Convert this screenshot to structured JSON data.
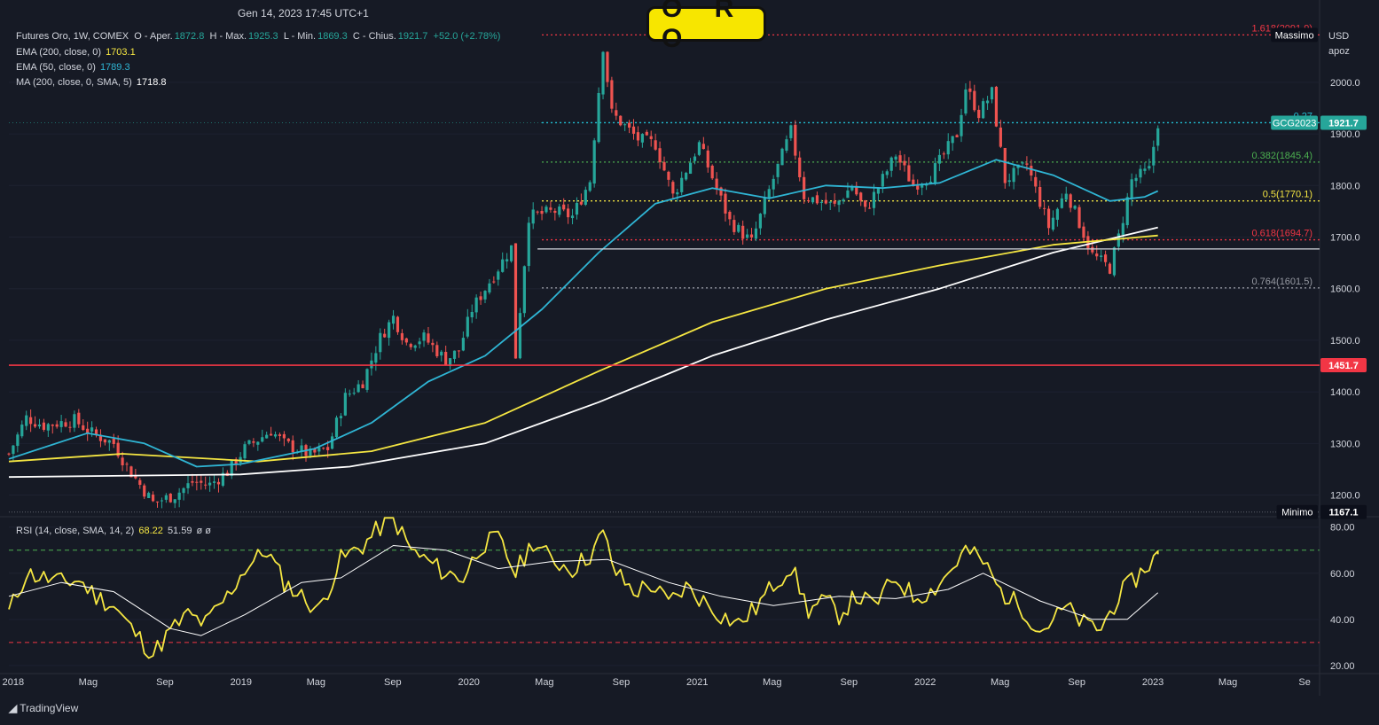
{
  "header": {
    "datetime": "Gen 14, 2023 17:45 UTC+1",
    "title": "O R O",
    "currency": "USD",
    "scale_label": "apoz",
    "watermark": "TradingView"
  },
  "legend": {
    "symbol_line": {
      "name": "Futures Oro, 1W, COMEX",
      "open_label": "O - Aper.",
      "open": "1872.8",
      "high_label": "H - Max.",
      "high": "1925.3",
      "low_label": "L - Min.",
      "low": "1869.3",
      "close_label": "C - Chius.",
      "close": "1921.7",
      "change": "+52.0 (+2.78%)"
    },
    "ema200": {
      "label": "EMA (200, close, 0)",
      "value": "1703.1",
      "color": "#f5e642"
    },
    "ema50": {
      "label": "EMA (50, close, 0)",
      "value": "1789.3",
      "color": "#2fb5d4"
    },
    "ma200": {
      "label": "MA (200, close, 0, SMA, 5)",
      "value": "1718.8",
      "color": "#ffffff"
    },
    "rsi": {
      "label": "RSI (14, close, SMA, 14, 2)",
      "value": "68.22",
      "value2": "51.59",
      "extra": "ø ø"
    }
  },
  "colors": {
    "background": "#161a25",
    "up": "#26a69a",
    "down": "#ef5350",
    "grid": "#1e2230",
    "ema200": "#f5e642",
    "ema50": "#2fb5d4",
    "ma200": "#ffffff",
    "support": "#f23645"
  },
  "chart_data": [
    {
      "type": "candlestick",
      "symbol": "GCG2023",
      "timeframe": "1W",
      "y_ticks": [
        "2000.0",
        "1900.0",
        "1800.0",
        "1700.0",
        "1600.0",
        "1500.0",
        "1400.0",
        "1300.0",
        "1200.0"
      ],
      "ylim": [
        1158,
        2108
      ],
      "x_ticks": [
        "2018",
        "Mag",
        "Sep",
        "2019",
        "Mag",
        "Sep",
        "2020",
        "Mag",
        "Sep",
        "2021",
        "Mag",
        "Sep",
        "2022",
        "Mag",
        "Sep",
        "2023",
        "Mag",
        "Se"
      ],
      "xlim": [
        "2017-12-25",
        "2023-09-25"
      ],
      "price_path": [
        [
          "2017-12-25",
          1280
        ],
        [
          "2018-01-22",
          1350
        ],
        [
          "2018-02-19",
          1335
        ],
        [
          "2018-04-09",
          1345
        ],
        [
          "2018-05-07",
          1320
        ],
        [
          "2018-06-11",
          1300
        ],
        [
          "2018-07-02",
          1255
        ],
        [
          "2018-08-13",
          1185
        ],
        [
          "2018-09-17",
          1200
        ],
        [
          "2018-10-15",
          1225
        ],
        [
          "2018-11-12",
          1220
        ],
        [
          "2018-12-10",
          1245
        ],
        [
          "2019-01-07",
          1290
        ],
        [
          "2019-02-18",
          1325
        ],
        [
          "2019-03-11",
          1300
        ],
        [
          "2019-04-22",
          1278
        ],
        [
          "2019-05-20",
          1290
        ],
        [
          "2019-06-17",
          1390
        ],
        [
          "2019-07-15",
          1420
        ],
        [
          "2019-08-12",
          1505
        ],
        [
          "2019-09-02",
          1545
        ],
        [
          "2019-09-23",
          1495
        ],
        [
          "2019-10-21",
          1505
        ],
        [
          "2019-11-25",
          1462
        ],
        [
          "2019-12-16",
          1480
        ],
        [
          "2020-01-06",
          1560
        ],
        [
          "2020-02-17",
          1640
        ],
        [
          "2020-03-09",
          1680
        ],
        [
          "2020-03-16",
          1470
        ],
        [
          "2020-04-06",
          1740
        ],
        [
          "2020-05-18",
          1750
        ],
        [
          "2020-06-15",
          1740
        ],
        [
          "2020-07-13",
          1810
        ],
        [
          "2020-08-03",
          2070
        ],
        [
          "2020-08-17",
          1940
        ],
        [
          "2020-09-28",
          1890
        ],
        [
          "2020-10-26",
          1880
        ],
        [
          "2020-11-23",
          1780
        ],
        [
          "2021-01-04",
          1880
        ],
        [
          "2021-02-22",
          1730
        ],
        [
          "2021-03-29",
          1690
        ],
        [
          "2021-04-26",
          1790
        ],
        [
          "2021-05-31",
          1905
        ],
        [
          "2021-06-21",
          1780
        ],
        [
          "2021-08-09",
          1760
        ],
        [
          "2021-09-06",
          1800
        ],
        [
          "2021-09-27",
          1750
        ],
        [
          "2021-11-15",
          1860
        ],
        [
          "2021-12-13",
          1800
        ],
        [
          "2022-01-10",
          1820
        ],
        [
          "2022-02-21",
          1900
        ],
        [
          "2022-03-07",
          1990
        ],
        [
          "2022-03-28",
          1940
        ],
        [
          "2022-04-18",
          1980
        ],
        [
          "2022-05-09",
          1810
        ],
        [
          "2022-06-13",
          1840
        ],
        [
          "2022-07-18",
          1720
        ],
        [
          "2022-08-15",
          1790
        ],
        [
          "2022-09-26",
          1665
        ],
        [
          "2022-10-24",
          1640
        ],
        [
          "2022-11-07",
          1700
        ],
        [
          "2022-11-28",
          1810
        ],
        [
          "2022-12-26",
          1830
        ],
        [
          "2023-01-09",
          1921.7
        ]
      ],
      "ema50_path": [
        [
          "2017-12-25",
          1270
        ],
        [
          "2018-04-30",
          1320
        ],
        [
          "2018-07-30",
          1300
        ],
        [
          "2018-10-22",
          1255
        ],
        [
          "2018-12-31",
          1260
        ],
        [
          "2019-04-29",
          1290
        ],
        [
          "2019-07-29",
          1340
        ],
        [
          "2019-10-28",
          1420
        ],
        [
          "2020-01-27",
          1470
        ],
        [
          "2020-04-27",
          1560
        ],
        [
          "2020-07-27",
          1670
        ],
        [
          "2020-10-26",
          1765
        ],
        [
          "2021-01-25",
          1795
        ],
        [
          "2021-04-26",
          1775
        ],
        [
          "2021-07-26",
          1800
        ],
        [
          "2021-10-25",
          1795
        ],
        [
          "2022-01-24",
          1805
        ],
        [
          "2022-04-25",
          1850
        ],
        [
          "2022-07-25",
          1820
        ],
        [
          "2022-10-24",
          1770
        ],
        [
          "2022-12-19",
          1778
        ],
        [
          "2023-01-09",
          1789.3
        ]
      ],
      "ema200_path": [
        [
          "2017-12-25",
          1265
        ],
        [
          "2018-06-25",
          1280
        ],
        [
          "2019-01-28",
          1265
        ],
        [
          "2019-07-29",
          1285
        ],
        [
          "2020-01-27",
          1340
        ],
        [
          "2020-07-27",
          1440
        ],
        [
          "2021-01-25",
          1535
        ],
        [
          "2021-07-26",
          1600
        ],
        [
          "2022-01-24",
          1645
        ],
        [
          "2022-07-25",
          1685
        ],
        [
          "2023-01-09",
          1703.1
        ]
      ],
      "ma200_path": [
        [
          "2017-12-25",
          1235
        ],
        [
          "2018-12-31",
          1240
        ],
        [
          "2019-06-24",
          1255
        ],
        [
          "2020-01-27",
          1300
        ],
        [
          "2020-07-27",
          1380
        ],
        [
          "2021-01-25",
          1470
        ],
        [
          "2021-07-26",
          1540
        ],
        [
          "2022-01-24",
          1600
        ],
        [
          "2022-07-25",
          1670
        ],
        [
          "2023-01-09",
          1718.8
        ]
      ],
      "fibonacci": [
        {
          "label": "1.618(2091.9)",
          "value": 2091.9,
          "color": "#f23645"
        },
        {
          "label": "0.27",
          "value": 1921.7,
          "color": "#22c1d6"
        },
        {
          "label": "0.382(1845.4)",
          "value": 1845.4,
          "color": "#4caf50"
        },
        {
          "label": "0.5(1770.1)",
          "value": 1770.1,
          "color": "#f5e642"
        },
        {
          "label": "0.618(1694.7)",
          "value": 1694.7,
          "color": "#f23645"
        },
        {
          "label": "0.764(1601.5)",
          "value": 1601.5,
          "color": "#9598a1"
        }
      ],
      "fib_start": "2020-04-27",
      "support_line": {
        "value": 1677,
        "start": "2020-04-20",
        "color": "#d1d4dc"
      },
      "horizontal_line": {
        "value": 1451.7,
        "color": "#f23645"
      },
      "price_badges": [
        {
          "text": "Massimo",
          "value": 2091.9,
          "kind": "label"
        },
        {
          "text": "GCG2023",
          "value": 1921.7,
          "kind": "label"
        },
        {
          "text": "1921.7",
          "value": 1921.7,
          "kind": "price-green"
        },
        {
          "text": "1451.7",
          "value": 1451.7,
          "kind": "price-red"
        },
        {
          "text": "Minimo",
          "value": 1167.1,
          "kind": "label"
        },
        {
          "text": "1167.1",
          "value": 1167.1,
          "kind": "price-dark"
        }
      ]
    },
    {
      "type": "line",
      "name": "RSI",
      "y_ticks": [
        "80.00",
        "60.00",
        "40.00",
        "20.00"
      ],
      "ylim": [
        16.5,
        84.5
      ],
      "levels": [
        {
          "value": 70,
          "color": "#4caf50"
        },
        {
          "value": 30,
          "color": "#f23645"
        }
      ],
      "rsi_path": [
        [
          "2017-12-25",
          43
        ],
        [
          "2018-01-22",
          60
        ],
        [
          "2018-02-19",
          58
        ],
        [
          "2018-03-19",
          56
        ],
        [
          "2018-04-16",
          57
        ],
        [
          "2018-05-14",
          50
        ],
        [
          "2018-06-11",
          46
        ],
        [
          "2018-07-09",
          36
        ],
        [
          "2018-08-13",
          25
        ],
        [
          "2018-09-10",
          35
        ],
        [
          "2018-10-08",
          42
        ],
        [
          "2018-11-05",
          38
        ],
        [
          "2018-12-10",
          50
        ],
        [
          "2019-01-07",
          62
        ],
        [
          "2019-02-11",
          70
        ],
        [
          "2019-03-11",
          56
        ],
        [
          "2019-04-08",
          50
        ],
        [
          "2019-05-06",
          44
        ],
        [
          "2019-06-10",
          66
        ],
        [
          "2019-07-15",
          72
        ],
        [
          "2019-08-12",
          80
        ],
        [
          "2019-09-02",
          84
        ],
        [
          "2019-09-30",
          70
        ],
        [
          "2019-10-28",
          65
        ],
        [
          "2019-11-25",
          60
        ],
        [
          "2019-12-23",
          58
        ],
        [
          "2020-01-20",
          72
        ],
        [
          "2020-02-17",
          75
        ],
        [
          "2020-03-16",
          60
        ],
        [
          "2020-04-13",
          74
        ],
        [
          "2020-05-11",
          66
        ],
        [
          "2020-06-15",
          62
        ],
        [
          "2020-07-13",
          68
        ],
        [
          "2020-08-03",
          77
        ],
        [
          "2020-08-24",
          60
        ],
        [
          "2020-09-21",
          52
        ],
        [
          "2020-10-19",
          55
        ],
        [
          "2020-11-16",
          47
        ],
        [
          "2020-12-14",
          54
        ],
        [
          "2021-01-11",
          48
        ],
        [
          "2021-02-08",
          42
        ],
        [
          "2021-03-08",
          38
        ],
        [
          "2021-04-05",
          45
        ],
        [
          "2021-05-03",
          55
        ],
        [
          "2021-05-31",
          63
        ],
        [
          "2021-06-28",
          44
        ],
        [
          "2021-07-26",
          48
        ],
        [
          "2021-08-16",
          42
        ],
        [
          "2021-09-13",
          50
        ],
        [
          "2021-10-11",
          46
        ],
        [
          "2021-11-15",
          58
        ],
        [
          "2021-12-13",
          50
        ],
        [
          "2022-01-10",
          52
        ],
        [
          "2022-02-07",
          60
        ],
        [
          "2022-03-07",
          70
        ],
        [
          "2022-04-04",
          65
        ],
        [
          "2022-05-02",
          52
        ],
        [
          "2022-06-06",
          45
        ],
        [
          "2022-07-04",
          35
        ],
        [
          "2022-08-15",
          45
        ],
        [
          "2022-09-12",
          38
        ],
        [
          "2022-10-10",
          36
        ],
        [
          "2022-11-07",
          50
        ],
        [
          "2022-12-05",
          58
        ],
        [
          "2023-01-09",
          68.22
        ]
      ],
      "rsi_ma_path": [
        [
          "2017-12-25",
          50
        ],
        [
          "2018-03-19",
          56
        ],
        [
          "2018-06-11",
          52
        ],
        [
          "2018-09-10",
          36
        ],
        [
          "2018-10-29",
          33
        ],
        [
          "2019-01-07",
          42
        ],
        [
          "2019-04-08",
          56
        ],
        [
          "2019-06-10",
          58
        ],
        [
          "2019-09-02",
          72
        ],
        [
          "2019-11-25",
          70
        ],
        [
          "2020-02-17",
          62
        ],
        [
          "2020-05-11",
          65
        ],
        [
          "2020-08-10",
          66
        ],
        [
          "2020-11-16",
          56
        ],
        [
          "2021-02-08",
          50
        ],
        [
          "2021-05-03",
          46
        ],
        [
          "2021-08-16",
          50
        ],
        [
          "2021-11-15",
          49
        ],
        [
          "2022-02-07",
          53
        ],
        [
          "2022-04-04",
          60
        ],
        [
          "2022-07-04",
          48
        ],
        [
          "2022-09-26",
          40
        ],
        [
          "2022-11-21",
          40
        ],
        [
          "2023-01-09",
          51.59
        ]
      ]
    }
  ]
}
